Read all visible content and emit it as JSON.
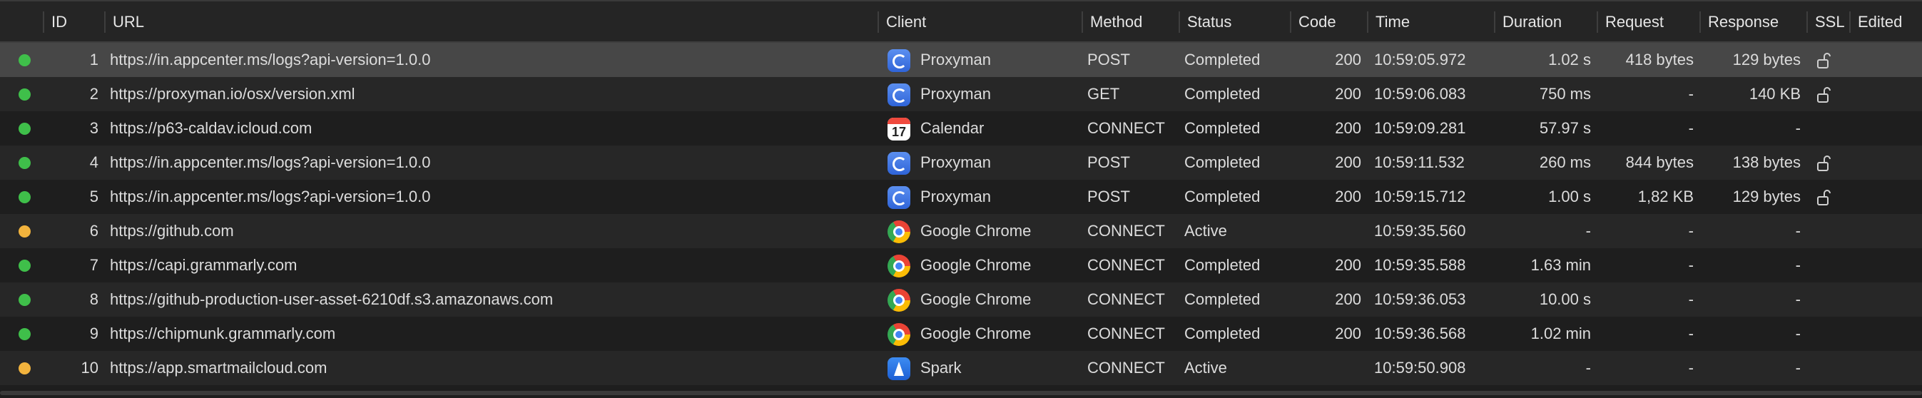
{
  "columns": {
    "id": "ID",
    "url": "URL",
    "client": "Client",
    "method": "Method",
    "status": "Status",
    "code": "Code",
    "time": "Time",
    "duration": "Duration",
    "request": "Request",
    "response": "Response",
    "ssl": "SSL",
    "edited": "Edited"
  },
  "colors": {
    "completed_dot": "#3fbf4a",
    "active_dot": "#f2b33d",
    "selected_row": "#474747"
  },
  "rows": [
    {
      "state": "completed",
      "id": "1",
      "url": "https://in.appcenter.ms/logs?api-version=1.0.0",
      "client": "Proxyman",
      "client_icon": "proxyman-icon",
      "method": "POST",
      "status": "Completed",
      "code": "200",
      "time": "10:59:05.972",
      "duration": "1.02 s",
      "request": "418 bytes",
      "response": "129 bytes",
      "ssl": "unlock-icon",
      "selected": true
    },
    {
      "state": "completed",
      "id": "2",
      "url": "https://proxyman.io/osx/version.xml",
      "client": "Proxyman",
      "client_icon": "proxyman-icon",
      "method": "GET",
      "status": "Completed",
      "code": "200",
      "time": "10:59:06.083",
      "duration": "750 ms",
      "request": "-",
      "response": "140 KB",
      "ssl": "unlock-icon"
    },
    {
      "state": "completed",
      "id": "3",
      "url": "https://p63-caldav.icloud.com",
      "client": "Calendar",
      "client_icon": "calendar-icon",
      "calendar_day": "17",
      "method": "CONNECT",
      "status": "Completed",
      "code": "200",
      "time": "10:59:09.281",
      "duration": "57.97 s",
      "request": "-",
      "response": "-",
      "ssl": ""
    },
    {
      "state": "completed",
      "id": "4",
      "url": "https://in.appcenter.ms/logs?api-version=1.0.0",
      "client": "Proxyman",
      "client_icon": "proxyman-icon",
      "method": "POST",
      "status": "Completed",
      "code": "200",
      "time": "10:59:11.532",
      "duration": "260 ms",
      "request": "844 bytes",
      "response": "138 bytes",
      "ssl": "unlock-icon"
    },
    {
      "state": "completed",
      "id": "5",
      "url": "https://in.appcenter.ms/logs?api-version=1.0.0",
      "client": "Proxyman",
      "client_icon": "proxyman-icon",
      "method": "POST",
      "status": "Completed",
      "code": "200",
      "time": "10:59:15.712",
      "duration": "1.00 s",
      "request": "1,82 KB",
      "response": "129 bytes",
      "ssl": "unlock-icon"
    },
    {
      "state": "active",
      "id": "6",
      "url": "https://github.com",
      "client": "Google Chrome",
      "client_icon": "chrome-icon",
      "method": "CONNECT",
      "status": "Active",
      "code": "",
      "time": "10:59:35.560",
      "duration": "-",
      "request": "-",
      "response": "-",
      "ssl": ""
    },
    {
      "state": "completed",
      "id": "7",
      "url": "https://capi.grammarly.com",
      "client": "Google Chrome",
      "client_icon": "chrome-icon",
      "method": "CONNECT",
      "status": "Completed",
      "code": "200",
      "time": "10:59:35.588",
      "duration": "1.63 min",
      "request": "-",
      "response": "-",
      "ssl": ""
    },
    {
      "state": "completed",
      "id": "8",
      "url": "https://github-production-user-asset-6210df.s3.amazonaws.com",
      "client": "Google Chrome",
      "client_icon": "chrome-icon",
      "method": "CONNECT",
      "status": "Completed",
      "code": "200",
      "time": "10:59:36.053",
      "duration": "10.00 s",
      "request": "-",
      "response": "-",
      "ssl": ""
    },
    {
      "state": "completed",
      "id": "9",
      "url": "https://chipmunk.grammarly.com",
      "client": "Google Chrome",
      "client_icon": "chrome-icon",
      "method": "CONNECT",
      "status": "Completed",
      "code": "200",
      "time": "10:59:36.568",
      "duration": "1.02 min",
      "request": "-",
      "response": "-",
      "ssl": ""
    },
    {
      "state": "active",
      "id": "10",
      "url": "https://app.smartmailcloud.com",
      "client": "Spark",
      "client_icon": "spark-icon",
      "method": "CONNECT",
      "status": "Active",
      "code": "",
      "time": "10:59:50.908",
      "duration": "-",
      "request": "-",
      "response": "-",
      "ssl": ""
    }
  ]
}
